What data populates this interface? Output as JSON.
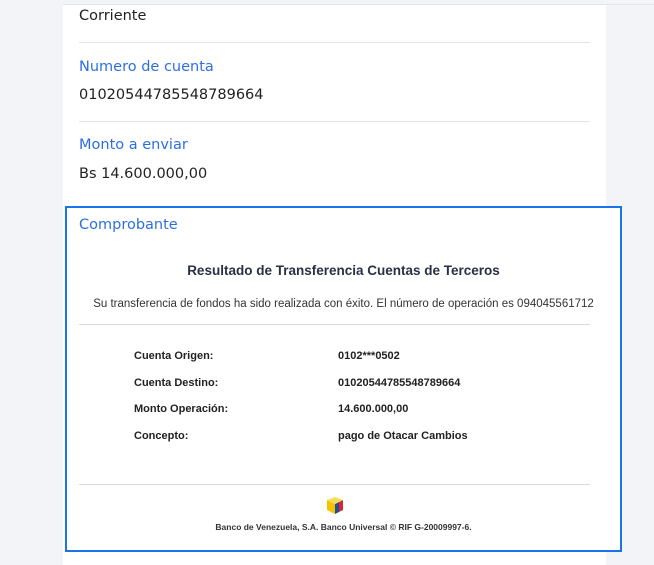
{
  "account_type": {
    "value": "Corriente"
  },
  "account_number": {
    "label": "Numero de cuenta",
    "value": "01020544785548789664"
  },
  "amount": {
    "label": "Monto a enviar",
    "value": "Bs 14.600.000,00"
  },
  "receipt": {
    "label": "Comprobante",
    "title": "Resultado de Transferencia Cuentas de Terceros",
    "message": "Su transferencia de fondos ha sido realizada con éxito. El número de operación es 094045561712",
    "rows": [
      {
        "key": "Cuenta Origen:",
        "value": "0102***0502"
      },
      {
        "key": "Cuenta Destino:",
        "value": "01020544785548789664"
      },
      {
        "key": "Monto Operación:",
        "value": "14.600.000,00"
      },
      {
        "key": "Concepto:",
        "value": "pago de Otacar Cambios"
      }
    ],
    "footer": "Banco de Venezuela, S.A. Banco Universal © RIF G-20009997-6.",
    "logo_icon": "bdv-logo-icon",
    "colors": {
      "accent": "#1a73e8",
      "label": "#2d6fe0",
      "logo_yellow": "#f5c400",
      "logo_blue": "#1d4fa0",
      "logo_red": "#d8262a"
    }
  }
}
